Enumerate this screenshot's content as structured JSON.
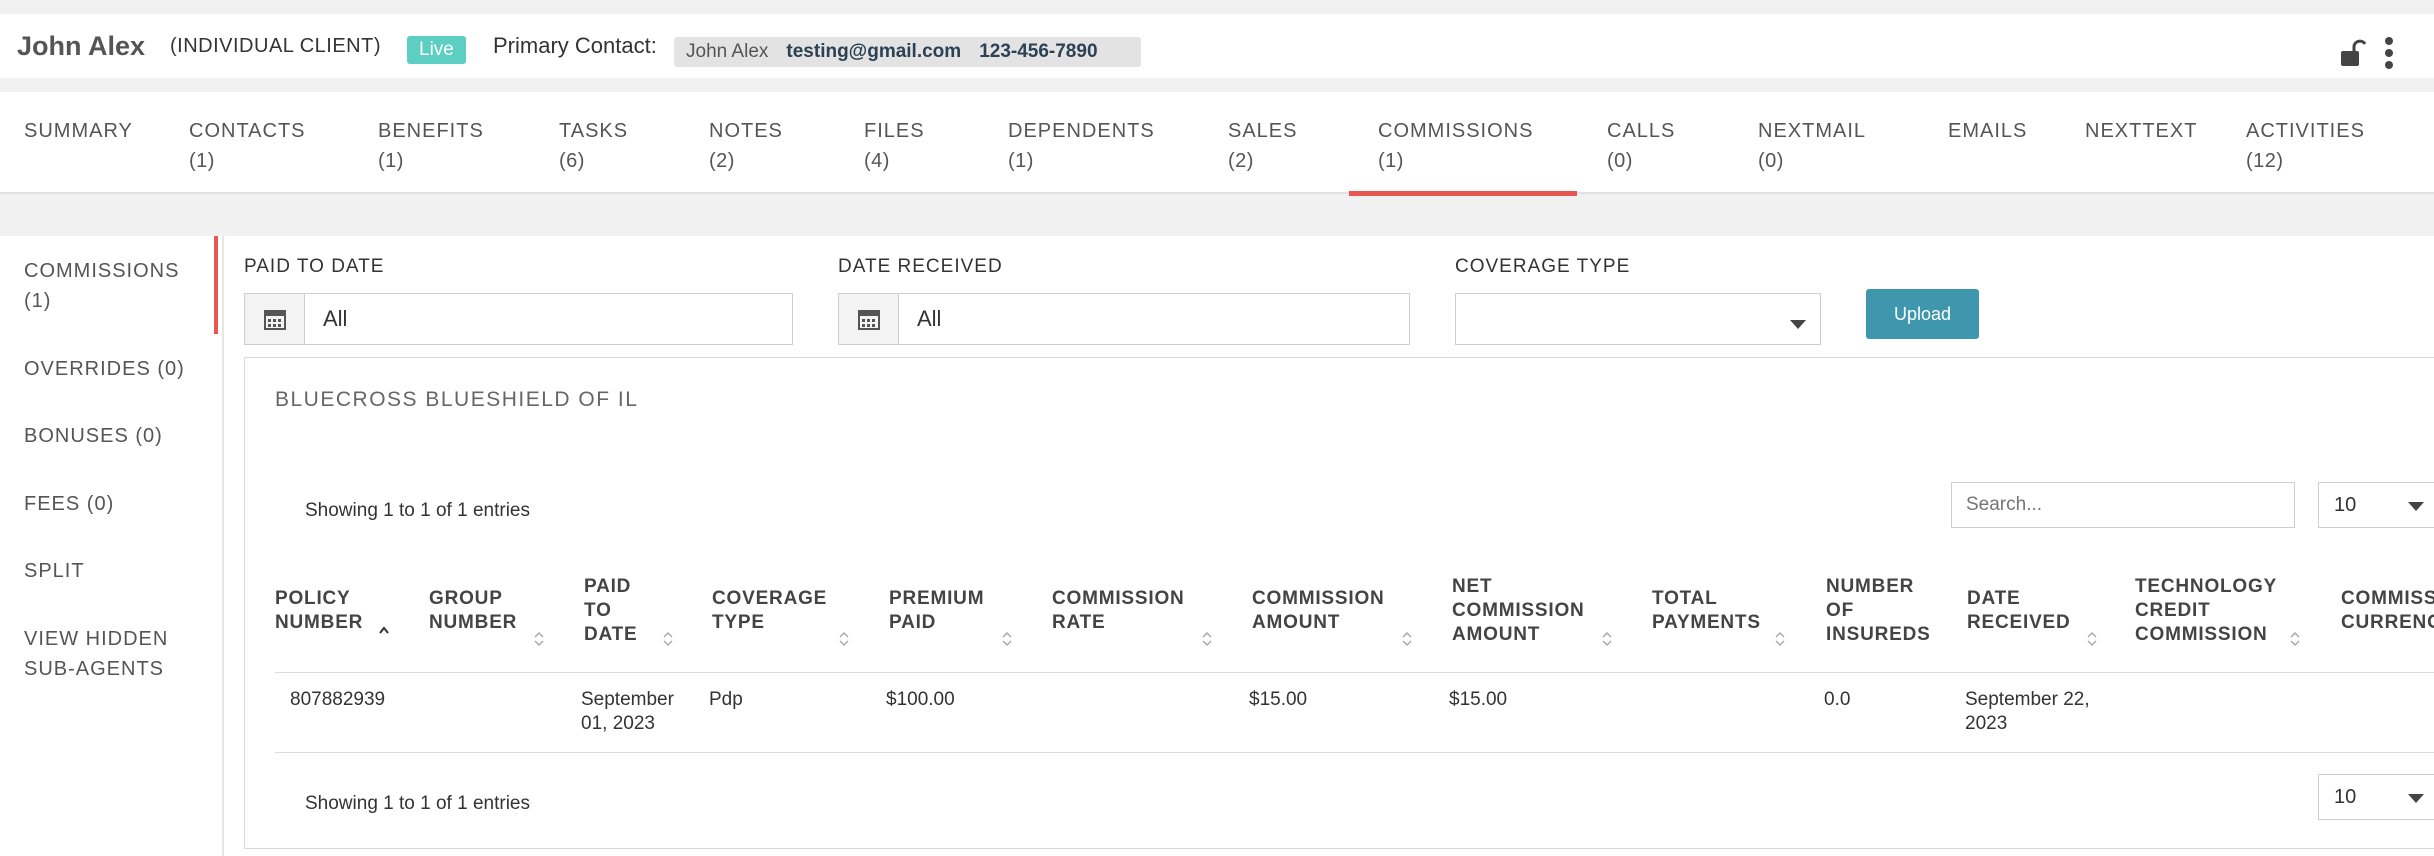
{
  "header": {
    "client_name": "John Alex",
    "client_type": "(INDIVIDUAL CLIENT)",
    "status_badge": "Live",
    "primary_contact_label": "Primary Contact:",
    "contact_name": "John Alex",
    "contact_email": "testing@gmail.com",
    "contact_phone": "123-456-7890",
    "icons": [
      "unlock-icon",
      "kebab-menu-icon"
    ]
  },
  "tabs": [
    {
      "label": "SUMMARY",
      "count": ""
    },
    {
      "label": "CONTACTS",
      "count": "(1)"
    },
    {
      "label": "BENEFITS",
      "count": "(1)"
    },
    {
      "label": "TASKS",
      "count": "(6)"
    },
    {
      "label": "NOTES",
      "count": "(2)"
    },
    {
      "label": "FILES",
      "count": "(4)"
    },
    {
      "label": "DEPENDENTS",
      "count": "(1)"
    },
    {
      "label": "SALES",
      "count": "(2)"
    },
    {
      "label": "COMMISSIONS",
      "count": "(1)"
    },
    {
      "label": "CALLS",
      "count": "(0)"
    },
    {
      "label": "NEXTMAIL",
      "count": "(0)"
    },
    {
      "label": "EMAILS",
      "count": ""
    },
    {
      "label": "NEXTTEXT",
      "count": ""
    },
    {
      "label": "ACTIVITIES",
      "count": "(12)"
    }
  ],
  "active_tab": "COMMISSIONS",
  "accent_color": "#e85752",
  "sidebar": {
    "items": [
      {
        "line1": "COMMISSIONS",
        "line2": "(1)"
      },
      {
        "line1": "OVERRIDES (0)",
        "line2": ""
      },
      {
        "line1": "BONUSES (0)",
        "line2": ""
      },
      {
        "line1": "FEES (0)",
        "line2": ""
      },
      {
        "line1": "SPLIT",
        "line2": ""
      },
      {
        "line1": "VIEW HIDDEN",
        "line2": "SUB-AGENTS"
      }
    ]
  },
  "filters": {
    "paid_to_date_label": "PAID TO DATE",
    "paid_to_date_value": "All",
    "date_received_label": "DATE RECEIVED",
    "date_received_value": "All",
    "coverage_type_label": "COVERAGE TYPE",
    "coverage_type_value": "",
    "upload_label": "Upload"
  },
  "carrier": {
    "title": "BLUECROSS BLUESHIELD OF IL",
    "showing_top": "Showing 1 to 1 of 1 entries",
    "showing_bottom": "Showing 1 to 1 of 1 entries",
    "search_placeholder": "Search...",
    "page_length": "10",
    "columns": [
      [
        "POLICY",
        "NUMBER"
      ],
      [
        "GROUP",
        "NUMBER"
      ],
      [
        "PAID",
        "TO",
        "DATE"
      ],
      [
        "COVERAGE",
        "TYPE"
      ],
      [
        "PREMIUM",
        "PAID"
      ],
      [
        "COMMISSION",
        "RATE"
      ],
      [
        "COMMISSION",
        "AMOUNT"
      ],
      [
        "NET",
        "COMMISSION",
        "AMOUNT"
      ],
      [
        "TOTAL",
        "PAYMENTS"
      ],
      [
        "NUMBER",
        "OF",
        "INSUREDS"
      ],
      [
        "DATE",
        "RECEIVED"
      ],
      [
        "TECHNOLOGY",
        "CREDIT",
        "COMMISSION"
      ],
      [
        "COMMISS",
        "CURRENC"
      ]
    ],
    "rows": [
      {
        "policy_number": "807882939",
        "group_number": "",
        "paid_to_date": [
          "September",
          "01, 2023"
        ],
        "coverage_type": "Pdp",
        "premium_paid": "$100.00",
        "commission_rate": "",
        "commission_amount": "$15.00",
        "net_commission_amount": "$15.00",
        "total_payments": "",
        "number_of_insureds": "0.0",
        "date_received": [
          "September 22,",
          "2023"
        ],
        "technology_credit_commission": ""
      }
    ]
  }
}
